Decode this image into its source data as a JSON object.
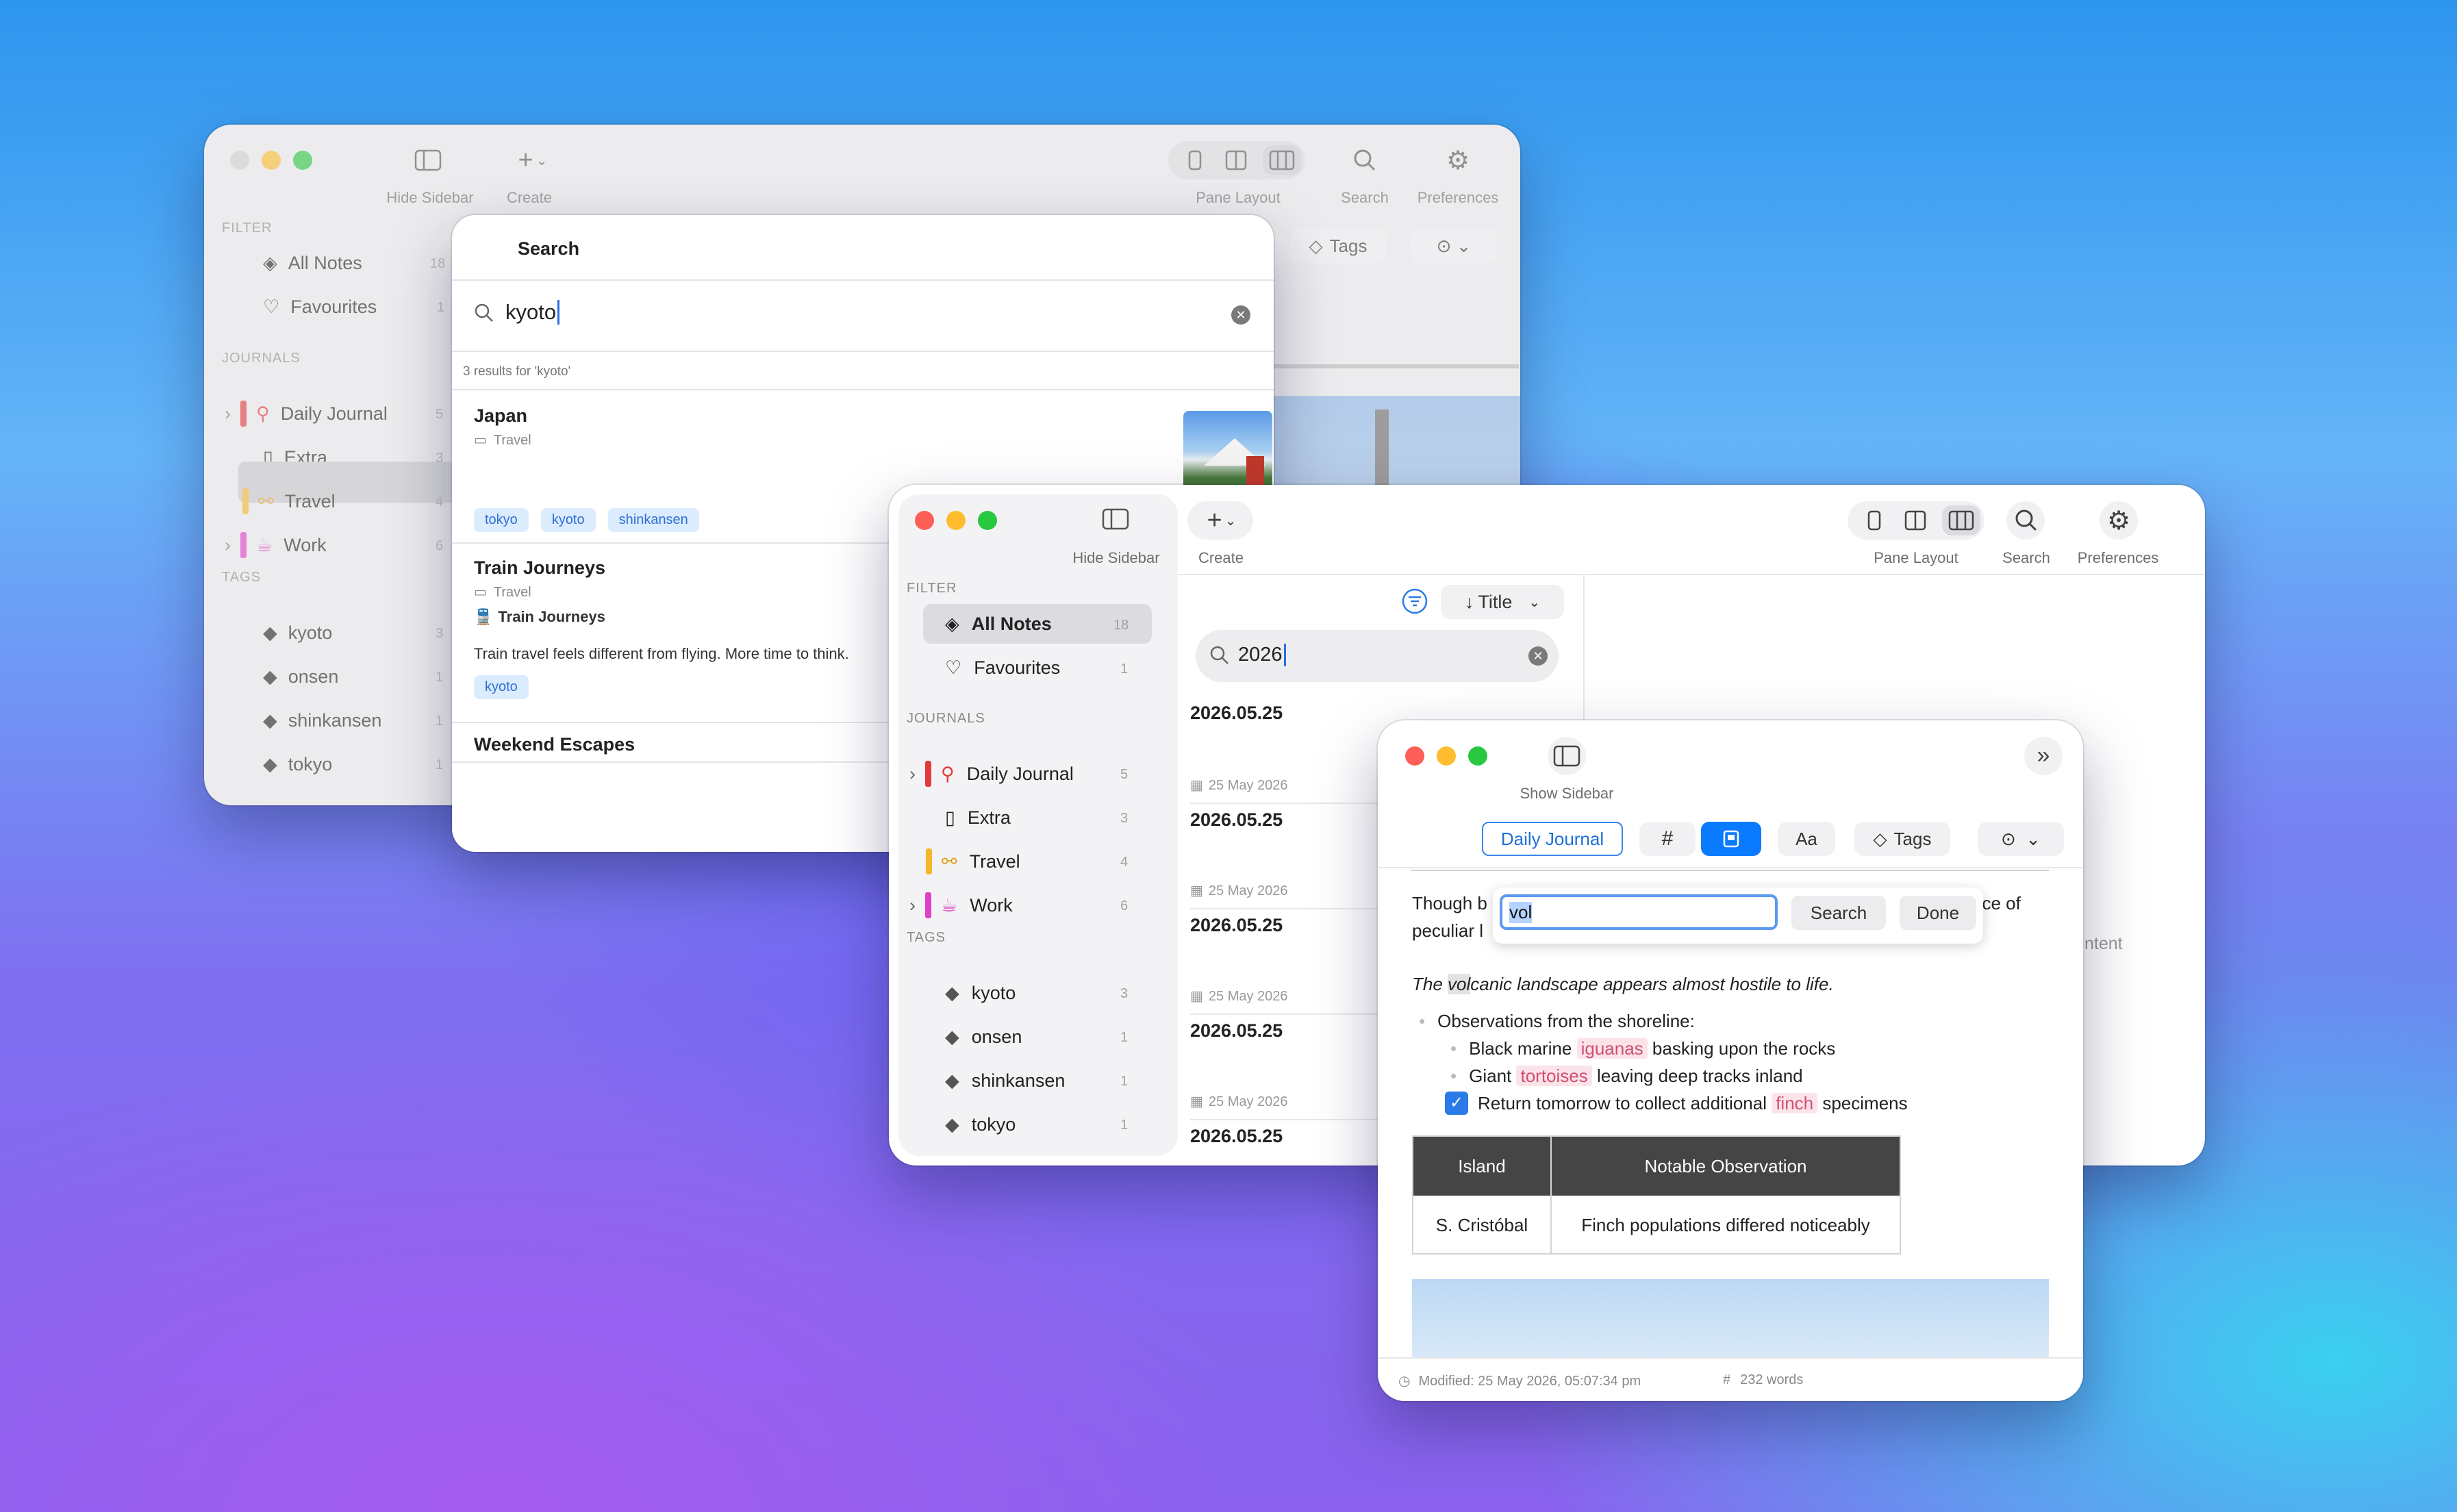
{
  "back_window": {
    "toolbar": {
      "hide_sidebar": "Hide Sidebar",
      "create": "Create",
      "pane_layout": "Pane Layout",
      "search": "Search",
      "preferences": "Preferences",
      "tags": "Tags"
    },
    "sidebar": {
      "filter_title": "FILTER",
      "filters": [
        {
          "label": "All Notes",
          "count": "18"
        },
        {
          "label": "Favourites",
          "count": "1"
        }
      ],
      "journals_title": "JOURNALS",
      "journals": [
        {
          "label": "Daily Journal",
          "count": "5"
        },
        {
          "label": "Extra",
          "count": "3"
        },
        {
          "label": "Travel",
          "count": "4"
        },
        {
          "label": "Work",
          "count": "6"
        }
      ],
      "tags_title": "TAGS",
      "tags": [
        {
          "label": "kyoto",
          "count": "3"
        },
        {
          "label": "onsen",
          "count": "1"
        },
        {
          "label": "shinkansen",
          "count": "1"
        },
        {
          "label": "tokyo",
          "count": "1"
        }
      ]
    }
  },
  "search_panel": {
    "title": "Search",
    "query": "kyoto",
    "results_summary": "3 results for 'kyoto'",
    "results": [
      {
        "title": "Japan",
        "journal": "Travel",
        "tags": [
          "tokyo",
          "kyoto",
          "shinkansen"
        ]
      },
      {
        "title": "Train Journeys",
        "journal": "Travel",
        "subtitle": "Train Journeys",
        "snippet": "Train travel feels different from flying. More time to think.",
        "tags": [
          "kyoto"
        ]
      },
      {
        "title": "Weekend Escapes"
      }
    ]
  },
  "main_window": {
    "toolbar": {
      "hide_sidebar": "Hide Sidebar",
      "create": "Create",
      "pane_layout": "Pane Layout",
      "search": "Search",
      "preferences": "Preferences"
    },
    "sidebar": {
      "filter_title": "FILTER",
      "filters": [
        {
          "label": "All Notes",
          "count": "18"
        },
        {
          "label": "Favourites",
          "count": "1"
        }
      ],
      "journals_title": "JOURNALS",
      "journals": [
        {
          "label": "Daily Journal",
          "count": "5",
          "color": "#e23a3a"
        },
        {
          "label": "Extra",
          "count": "3"
        },
        {
          "label": "Travel",
          "count": "4",
          "color": "#f5b82a"
        },
        {
          "label": "Work",
          "count": "6",
          "color": "#e040c8"
        }
      ],
      "tags_title": "TAGS",
      "tags": [
        {
          "label": "kyoto",
          "count": "3"
        },
        {
          "label": "onsen",
          "count": "1"
        },
        {
          "label": "shinkansen",
          "count": "1"
        },
        {
          "label": "tokyo",
          "count": "1"
        }
      ]
    },
    "note_list": {
      "sort_label": "Title",
      "search_value": "2026",
      "notes": [
        {
          "title": "2026.05.25",
          "date": "25 May 2026"
        },
        {
          "title": "2026.05.25",
          "date": "25 May 2026"
        },
        {
          "title": "2026.05.25",
          "date": "25 May 2026"
        },
        {
          "title": "2026.05.25",
          "date": "25 May 2026"
        },
        {
          "title": "2026.05.25"
        }
      ]
    },
    "empty_hint": "ntent"
  },
  "editor_window": {
    "show_sidebar": "Show Sidebar",
    "journal_button": "Daily Journal",
    "hash_button": "#",
    "font_button": "Aa",
    "tags_button": "Tags",
    "find": {
      "value": "vol",
      "search_button": "Search",
      "done_button": "Done"
    },
    "content": {
      "para_start_1": "Though b",
      "para_end_1": "nce of",
      "para_start_2": "peculiar l",
      "italic_match": "vol",
      "italic_rest": "canic landscape appears almost hostile to life.",
      "italic_prefix": "The ",
      "bullet_main": "Observations from the shoreline:",
      "sub1_pre": "Black marine ",
      "sub1_hl": "iguanas",
      "sub1_post": " basking upon the rocks",
      "sub2_pre": "Giant ",
      "sub2_hl": "tortoises",
      "sub2_post": " leaving deep tracks inland",
      "check_pre": "Return tomorrow to collect additional ",
      "check_hl": "finch",
      "check_post": " specimens"
    },
    "table": {
      "headers": [
        "Island",
        "Notable Observation"
      ],
      "rows": [
        [
          "S. Cristóbal",
          "Finch populations differed noticeably"
        ]
      ]
    },
    "status": {
      "modified": "Modified: 25 May 2026, 05:07:34 pm",
      "words": "232 words"
    }
  },
  "colors": {
    "accent": "#0a7aff",
    "travel_bar": "#f5b82a",
    "daily_bar": "#e23a3a",
    "work_bar": "#e040c8"
  }
}
